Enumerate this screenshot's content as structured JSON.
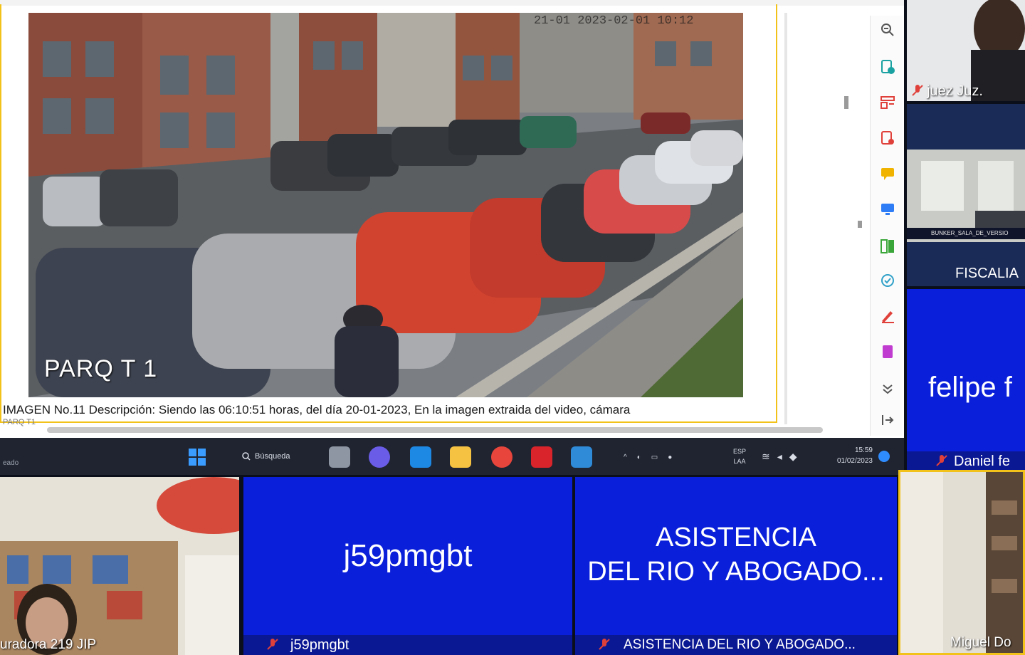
{
  "shared_screen": {
    "camera_label": "PARQ T 1",
    "camera_timestamp": "21-01 2023-02-01 10:12",
    "caption": "IMAGEN No.11 Descripción: Siendo las 06:10:51 horas, del día 20-01-2023, En la imagen extraida del video, cámara",
    "caption_cut": "PARQ T1"
  },
  "side_tools": [
    {
      "icon": "zoom-icon",
      "color": "#555555"
    },
    {
      "icon": "add-document-icon",
      "color": "#1aa1a1"
    },
    {
      "icon": "layout-icon",
      "color": "#e0403a"
    },
    {
      "icon": "export-document-icon",
      "color": "#e0403a"
    },
    {
      "icon": "comment-icon",
      "color": "#f0b400"
    },
    {
      "icon": "screen-share-icon",
      "color": "#2f7df6"
    },
    {
      "icon": "compare-icon",
      "color": "#3aa63a"
    },
    {
      "icon": "scan-icon",
      "color": "#2fa0c8"
    },
    {
      "icon": "sign-icon",
      "color": "#e0403a"
    },
    {
      "icon": "pdf-icon",
      "color": "#c03bd0"
    },
    {
      "icon": "collapse-icon",
      "color": "#555555"
    },
    {
      "icon": "exit-icon",
      "color": "#555555"
    }
  ],
  "taskbar": {
    "left_text": "eado",
    "search_label": "Búsqueda",
    "lang_top": "ESP",
    "lang_bottom": "LAA",
    "time": "15:59",
    "date": "01/02/2023"
  },
  "participants": {
    "juez": "juez Juz.",
    "fiscalia_room": "BUNKER_SALA_DE_VERSIO",
    "fiscalia": "FISCALIA",
    "felipe_big": "felipe f",
    "felipe_name": "Daniel fe",
    "curadora": "uradora 219 JIP",
    "j59_big": "j59pmgbt",
    "j59_name": "j59pmgbt",
    "asistencia_big_line1": "ASISTENCIA",
    "asistencia_big_line2": "DEL RIO Y ABOGADO...",
    "asistencia_name": "ASISTENCIA DEL RIO Y ABOGADO...",
    "miguel_name": "Miguel Do"
  },
  "colors": {
    "tile_blue": "#0a1fd9",
    "highlight": "#f2c21a",
    "mic_off": "#e0403a"
  }
}
